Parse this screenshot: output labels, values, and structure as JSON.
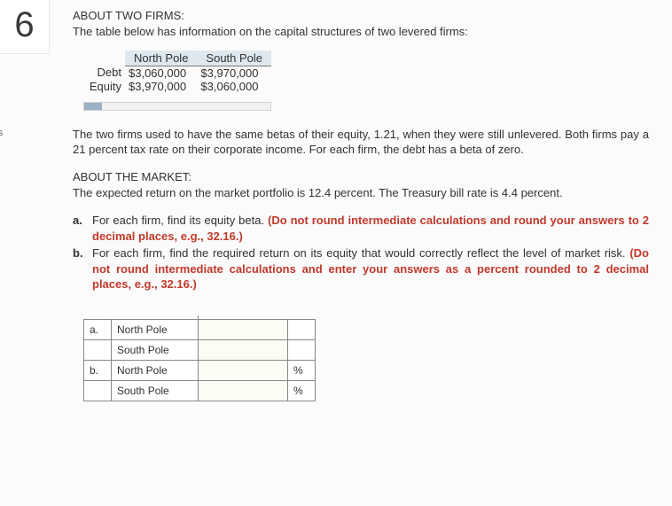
{
  "question_number": "6",
  "points_label": "oints",
  "section1_heading": "ABOUT TWO FIRMS:",
  "section1_intro": "The table below has information on the capital structures of two levered firms:",
  "data_table": {
    "col1": "North Pole",
    "col2": "South Pole",
    "rows": [
      {
        "label": "Debt",
        "v1": "$3,060,000",
        "v2": "$3,970,000"
      },
      {
        "label": "Equity",
        "v1": "$3,970,000",
        "v2": "$3,060,000"
      }
    ]
  },
  "paragraph1": "The two firms used to have the same betas of their equity, 1.21, when they were still unlevered. Both firms pay a 21 percent tax rate on their corporate income. For each firm, the debt has a beta of zero.",
  "section2_heading": "ABOUT THE MARKET:",
  "paragraph2": "The expected return on the market portfolio is 12.4 percent. The Treasury bill rate is 4.4 percent.",
  "qa": {
    "label": "a.",
    "pre": "For each firm, find its equity beta. ",
    "red": "(Do not round intermediate calculations and round your answers to 2 decimal places, e.g., 32.16.)"
  },
  "qb": {
    "label": "b.",
    "pre": "For each firm, find the required return on its equity that would correctly reflect the level of market risk. ",
    "red": "(Do not round intermediate calculations and enter your answers as a percent rounded to 2 decimal places, e.g., 32.16.)"
  },
  "answers": {
    "rows": [
      {
        "part": "a.",
        "name": "North Pole",
        "unit": ""
      },
      {
        "part": "",
        "name": "South Pole",
        "unit": ""
      },
      {
        "part": "b.",
        "name": "North Pole",
        "unit": "%"
      },
      {
        "part": "",
        "name": "South Pole",
        "unit": "%"
      }
    ]
  }
}
